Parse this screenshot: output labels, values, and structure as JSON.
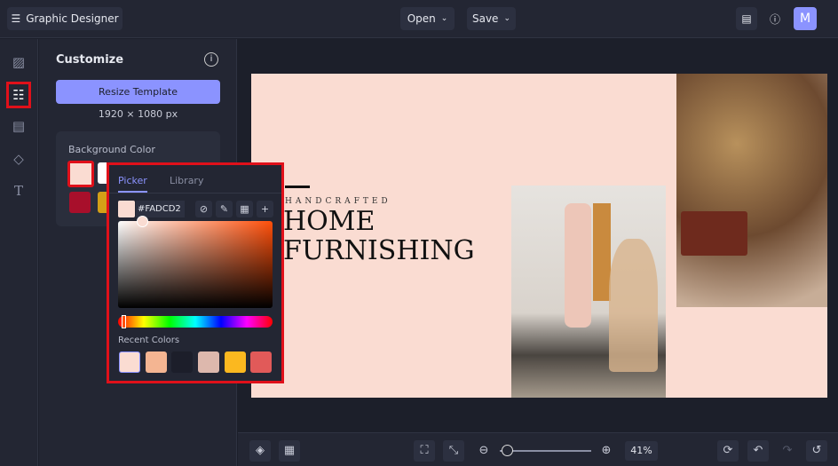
{
  "header": {
    "app_title": "Graphic Designer",
    "open_label": "Open",
    "save_label": "Save",
    "avatar_initial": "M"
  },
  "panel": {
    "title": "Customize",
    "resize_label": "Resize Template",
    "dimensions": "1920 × 1080 px",
    "bg_color_label": "Background Color"
  },
  "picker": {
    "tab_picker": "Picker",
    "tab_library": "Library",
    "hex": "#FADCD2",
    "recent_label": "Recent Colors",
    "recent_colors": [
      "#fadcd2",
      "#f4b592",
      "#1c1e2a",
      "#ddb8ad",
      "#fbb81f",
      "#e15a59"
    ],
    "hue_fraction": 0.02
  },
  "swatches": [
    "#fadcd2",
    "#ffffff",
    "#a80f2b",
    "#d4a017"
  ],
  "canvas": {
    "kicker": "HANDCRAFTED",
    "line1": "HOME",
    "line2": "FURNISHING",
    "background": "#FADCD2"
  },
  "toolbar": {
    "zoom_level": "41%",
    "zoom_fraction": 0.08
  }
}
